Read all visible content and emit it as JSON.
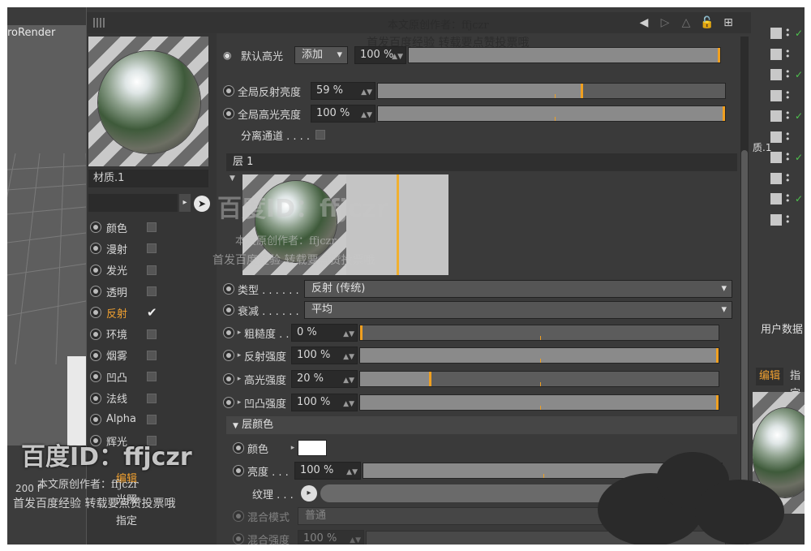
{
  "viewport": {
    "title": "roRender",
    "frame_value": "200 F"
  },
  "editor": {
    "material_name": "材质.1",
    "channels": [
      {
        "label": "颜色",
        "checked": false,
        "active": false
      },
      {
        "label": "漫射",
        "checked": false,
        "active": false
      },
      {
        "label": "发光",
        "checked": false,
        "active": false
      },
      {
        "label": "透明",
        "checked": false,
        "active": false
      },
      {
        "label": "反射",
        "checked": true,
        "active": true
      },
      {
        "label": "环境",
        "checked": false,
        "active": false
      },
      {
        "label": "烟雾",
        "checked": false,
        "active": false
      },
      {
        "label": "凹凸",
        "checked": false,
        "active": false
      },
      {
        "label": "法线",
        "checked": false,
        "active": false
      },
      {
        "label": "Alpha",
        "checked": false,
        "active": false
      },
      {
        "label": "辉光",
        "checked": false,
        "active": false
      }
    ],
    "lower_items": [
      "编辑",
      "光照",
      "指定"
    ],
    "default_specular": {
      "label": "默认高光",
      "mode": "添加",
      "value": "100 %",
      "level": 1.0
    },
    "global_reflection": {
      "label": "全局反射亮度",
      "value": "59 %",
      "level": 0.59
    },
    "global_specular": {
      "label": "全局高光亮度",
      "value": "100 %",
      "level": 1.0
    },
    "separate_pass": {
      "label": "分离通道 . . . ."
    },
    "layer_header": "层 1",
    "type": {
      "label": "类型 . . . . . .",
      "value": "反射 (传统)"
    },
    "attenuation": {
      "label": "衰减 . . . . . .",
      "value": "平均"
    },
    "roughness": {
      "label": "粗糙度 . .",
      "value": "0 %",
      "level": 0.0
    },
    "reflection_strength": {
      "label": "反射强度",
      "value": "100 %",
      "level": 1.0
    },
    "specular_strength": {
      "label": "高光强度",
      "value": "20 %",
      "level": 0.2
    },
    "bump_strength": {
      "label": "凹凸强度",
      "value": "100 %",
      "level": 1.0
    },
    "layer_color_section": "层颜色",
    "color": {
      "label": "颜色",
      "swatch": "#ffffff"
    },
    "brightness": {
      "label": "亮度 . . .",
      "value": "100 %",
      "level": 1.0
    },
    "texture": {
      "label": "纹理 . . ."
    },
    "blend_mode": {
      "label": "混合模式",
      "value": "普通"
    },
    "blend_strength": {
      "label": "混合强度",
      "value": "100 %"
    }
  },
  "right_panel": {
    "user_data": "用户数据",
    "tab_edit": "编辑",
    "tab_assign": "指定",
    "object_suffix": "质.1"
  },
  "watermarks": {
    "id_text": "百度ID：ffjczr",
    "author": "本文原创作者：ffjczr",
    "slogan": "首发百度经验  转载要点赞投票哦"
  },
  "colors": {
    "accent": "#f0a030",
    "panel": "#3a3a3a",
    "ok_green": "#4ec24e"
  }
}
